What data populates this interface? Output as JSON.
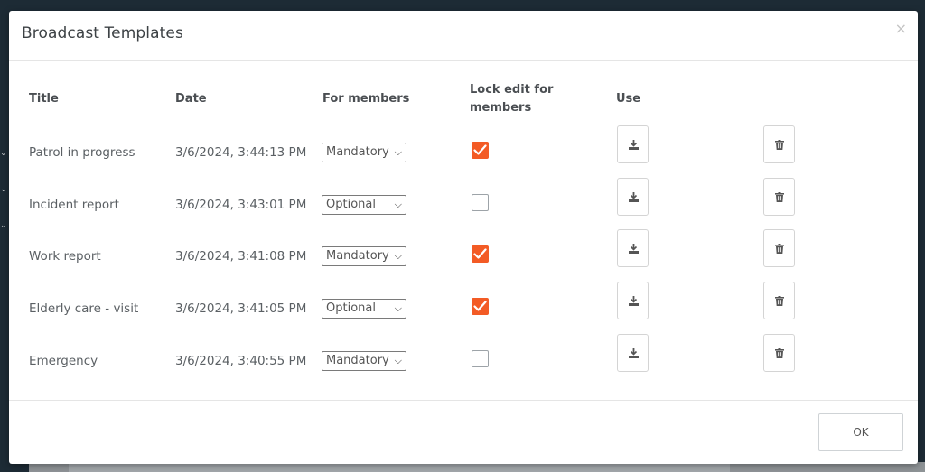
{
  "modal": {
    "title": "Broadcast Templates",
    "close_label": "×",
    "ok_label": "OK"
  },
  "columns": {
    "title": "Title",
    "date": "Date",
    "for_members": "For members",
    "lock_edit_line1": "Lock edit for",
    "lock_edit_line2": "members",
    "use": "Use"
  },
  "rows": [
    {
      "title": "Patrol in progress",
      "date": "3/6/2024, 3:44:13 PM",
      "for_members": "Mandatory",
      "locked": true
    },
    {
      "title": "Incident report",
      "date": "3/6/2024, 3:43:01 PM",
      "for_members": "Optional",
      "locked": false
    },
    {
      "title": "Work report",
      "date": "3/6/2024, 3:41:08 PM",
      "for_members": "Mandatory",
      "locked": true
    },
    {
      "title": "Elderly care - visit",
      "date": "3/6/2024, 3:41:05 PM",
      "for_members": "Optional",
      "locked": true
    },
    {
      "title": "Emergency",
      "date": "3/6/2024, 3:40:55 PM",
      "for_members": "Mandatory",
      "locked": false
    }
  ],
  "icons": {
    "use": "download-icon",
    "delete": "trash-icon",
    "checkbox_checked": "check-icon",
    "select_arrow": "chevron-down-icon",
    "side": "chevron-down-icon"
  },
  "colors": {
    "accent": "#f35b25",
    "backdrop": "#1d2b35"
  }
}
